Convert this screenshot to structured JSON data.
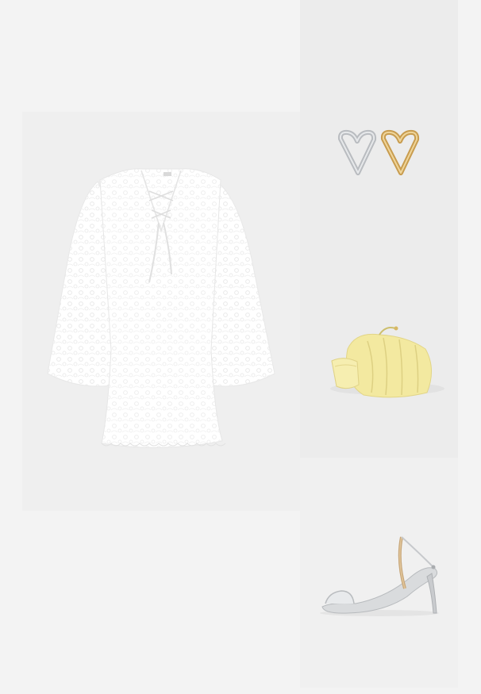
{
  "collage": {
    "background": "#f3f3f3",
    "items": [
      {
        "name": "white-lace-dress",
        "color": "#ffffff"
      },
      {
        "name": "heart-hoop-earrings",
        "colors": [
          "#c9cccf",
          "#d6b06a"
        ]
      },
      {
        "name": "yellow-pouch-bag",
        "color": "#f4eba6"
      },
      {
        "name": "silver-heeled-sandal",
        "color": "#d8dadc"
      }
    ]
  }
}
